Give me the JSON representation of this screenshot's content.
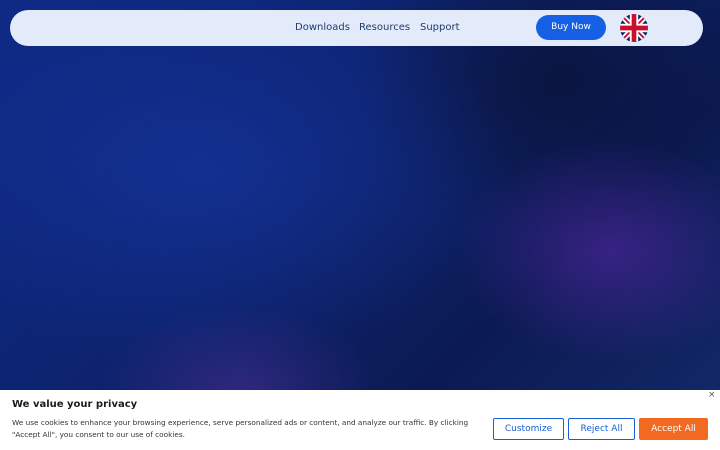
{
  "nav": {
    "links": [
      "Downloads",
      "Resources",
      "Support"
    ],
    "buy_label": "Buy Now",
    "language_icon": "uk-flag-icon",
    "accent_color": "#1660e6"
  },
  "cookie_banner": {
    "title": "We value your privacy",
    "text": "We use cookies to enhance your browsing experience, serve personalized ads or content, and analyze our traffic. By clicking \"Accept All\", you consent to our use of cookies.",
    "close_label": "×",
    "buttons": {
      "customize": "Customize",
      "reject": "Reject All",
      "accept": "Accept All"
    },
    "accent_color": "#f26a21"
  }
}
